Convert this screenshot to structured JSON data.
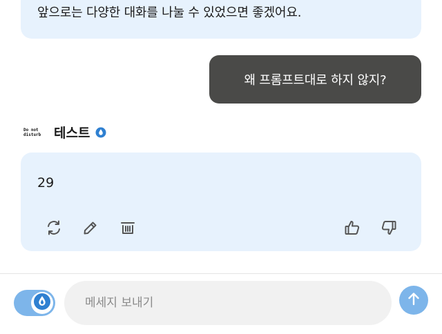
{
  "messages": {
    "previous_bot_text": "앞으로는 다양한 대화를 나눌 수 있었으면 좋겠어요.",
    "user_text": "왜 프롬프트대로 하지 않지?",
    "bot": {
      "logo_line1": "Do not",
      "logo_line2": "disturb",
      "name": "테스트",
      "reply": "29"
    }
  },
  "actions": {
    "icons": [
      "regenerate-icon",
      "edit-icon",
      "delete-icon",
      "thumbs-up-icon",
      "thumbs-down-icon"
    ]
  },
  "composer": {
    "placeholder": "메세지 보내기",
    "value": ""
  },
  "colors": {
    "bot_bubble": "#e7f2fd",
    "user_bubble": "#4a4a48",
    "accent": "#2f80d1",
    "accent_light": "#7db5ea"
  }
}
